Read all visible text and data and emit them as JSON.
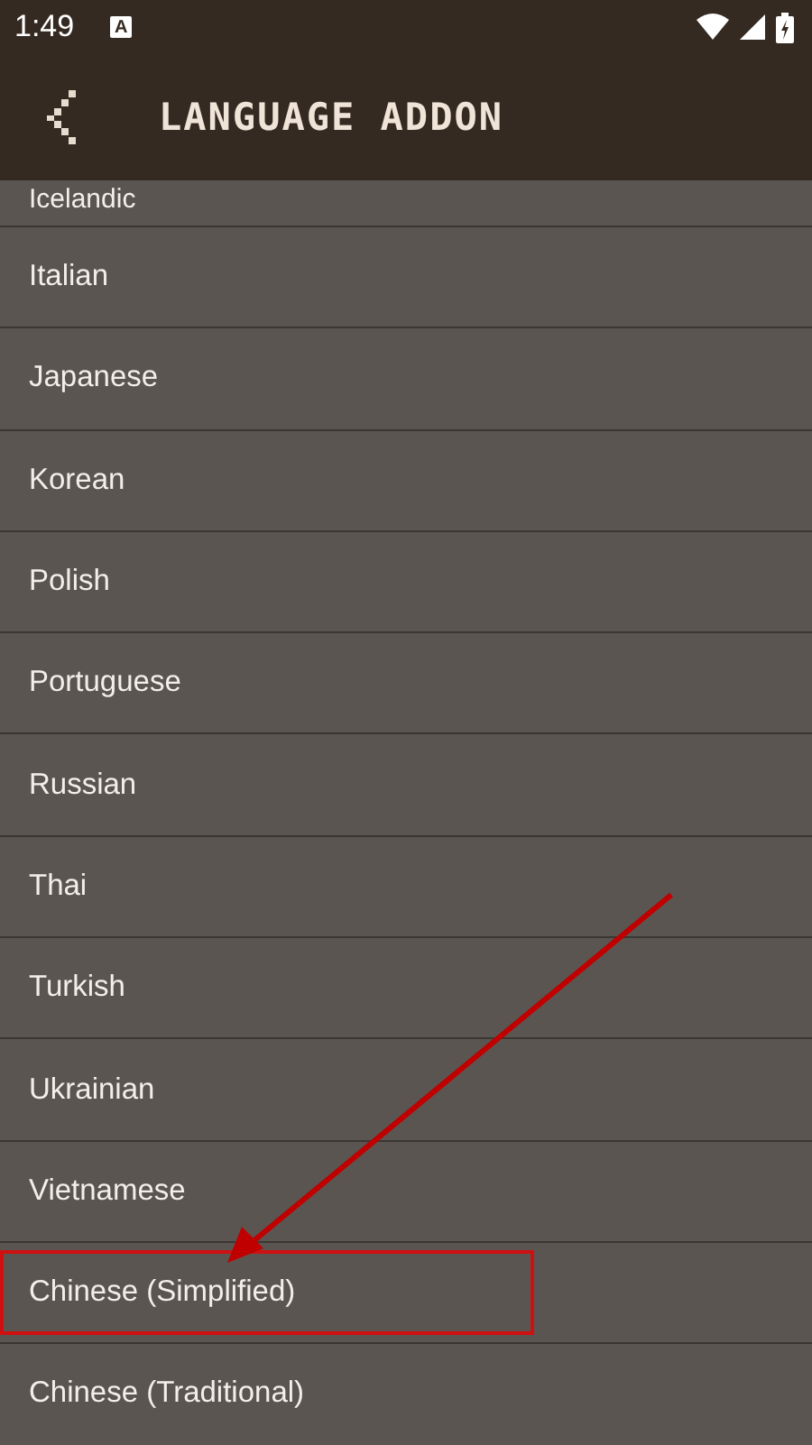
{
  "status_bar": {
    "time": "1:49",
    "notification": "A"
  },
  "header": {
    "title": "LANGUAGE ADDON"
  },
  "languages": [
    {
      "label": "Icelandic",
      "highlighted": false
    },
    {
      "label": "Italian",
      "highlighted": false
    },
    {
      "label": "Japanese",
      "highlighted": false
    },
    {
      "label": "Korean",
      "highlighted": false
    },
    {
      "label": "Polish",
      "highlighted": false
    },
    {
      "label": "Portuguese",
      "highlighted": false
    },
    {
      "label": "Russian",
      "highlighted": false
    },
    {
      "label": "Thai",
      "highlighted": false
    },
    {
      "label": "Turkish",
      "highlighted": false
    },
    {
      "label": "Ukrainian",
      "highlighted": false
    },
    {
      "label": "Vietnamese",
      "highlighted": false
    },
    {
      "label": "Chinese (Simplified)",
      "highlighted": true
    },
    {
      "label": "Chinese (Traditional)",
      "highlighted": false
    }
  ]
}
